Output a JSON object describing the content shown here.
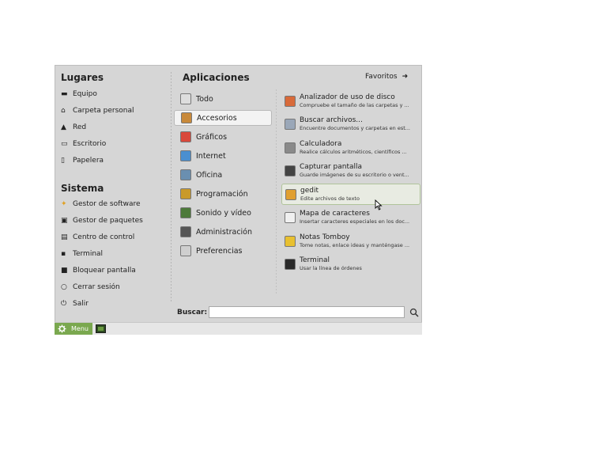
{
  "places": {
    "header": "Lugares",
    "items": [
      {
        "label": "Equipo",
        "icon": "computer-icon"
      },
      {
        "label": "Carpeta personal",
        "icon": "home-icon"
      },
      {
        "label": "Red",
        "icon": "network-icon"
      },
      {
        "label": "Escritorio",
        "icon": "desktop-icon"
      },
      {
        "label": "Papelera",
        "icon": "trash-icon"
      }
    ]
  },
  "system": {
    "header": "Sistema",
    "items": [
      {
        "label": "Gestor de software",
        "icon": "software-icon"
      },
      {
        "label": "Gestor de paquetes",
        "icon": "package-icon"
      },
      {
        "label": "Centro de control",
        "icon": "control-center-icon"
      },
      {
        "label": "Terminal",
        "icon": "terminal-icon"
      },
      {
        "label": "Bloquear pantalla",
        "icon": "lock-icon"
      },
      {
        "label": "Cerrar sesión",
        "icon": "logout-icon"
      },
      {
        "label": "Salir",
        "icon": "power-icon"
      }
    ]
  },
  "applications": {
    "header": "Aplicaciones",
    "favorites_label": "Favoritos",
    "categories": [
      {
        "label": "Todo",
        "icon": "all-icon",
        "color": "#dddddd"
      },
      {
        "label": "Accesorios",
        "icon": "accessories-icon",
        "color": "#c8893a",
        "selected": true
      },
      {
        "label": "Gráficos",
        "icon": "graphics-icon",
        "color": "#d9483b"
      },
      {
        "label": "Internet",
        "icon": "internet-icon",
        "color": "#4a8fd0"
      },
      {
        "label": "Oficina",
        "icon": "office-icon",
        "color": "#6a8fb0"
      },
      {
        "label": "Programación",
        "icon": "programming-icon",
        "color": "#c99a2a"
      },
      {
        "label": "Sonido y vídeo",
        "icon": "sound-video-icon",
        "color": "#4d7a3a"
      },
      {
        "label": "Administración",
        "icon": "administration-icon",
        "color": "#555555"
      },
      {
        "label": "Preferencias",
        "icon": "preferences-icon",
        "color": "#cfcfcf"
      }
    ],
    "apps": [
      {
        "name": "Analizador de uso de disco",
        "desc": "Compruebe el tamaño de las carpetas y ...",
        "icon": "disk-usage-icon",
        "color": "#d86a3a"
      },
      {
        "name": "Buscar archivos...",
        "desc": "Encuentre documentos y carpetas en est...",
        "icon": "search-files-icon",
        "color": "#9aa7b8"
      },
      {
        "name": "Calculadora",
        "desc": "Realice cálculos aritméticos, científicos ...",
        "icon": "calculator-icon",
        "color": "#8a8a8a"
      },
      {
        "name": "Capturar pantalla",
        "desc": "Guarde imágenes de su escritorio o vent...",
        "icon": "screenshot-icon",
        "color": "#444444"
      },
      {
        "name": "gedit",
        "desc": "Edite archivos de texto",
        "icon": "gedit-icon",
        "color": "#e0a030",
        "highlighted": true
      },
      {
        "name": "Mapa de caracteres",
        "desc": "Insertar caracteres especiales en los doc...",
        "icon": "character-map-icon",
        "color": "#f0f0f0"
      },
      {
        "name": "Notas Tomboy",
        "desc": "Tome notas, enlace ideas y manténgase ...",
        "icon": "tomboy-icon",
        "color": "#e8c030"
      },
      {
        "name": "Terminal",
        "desc": "Usar la línea de órdenes",
        "icon": "terminal-app-icon",
        "color": "#2a2a2a"
      }
    ]
  },
  "search": {
    "label": "Buscar:",
    "value": ""
  },
  "panel": {
    "menu_label": "Menu"
  }
}
